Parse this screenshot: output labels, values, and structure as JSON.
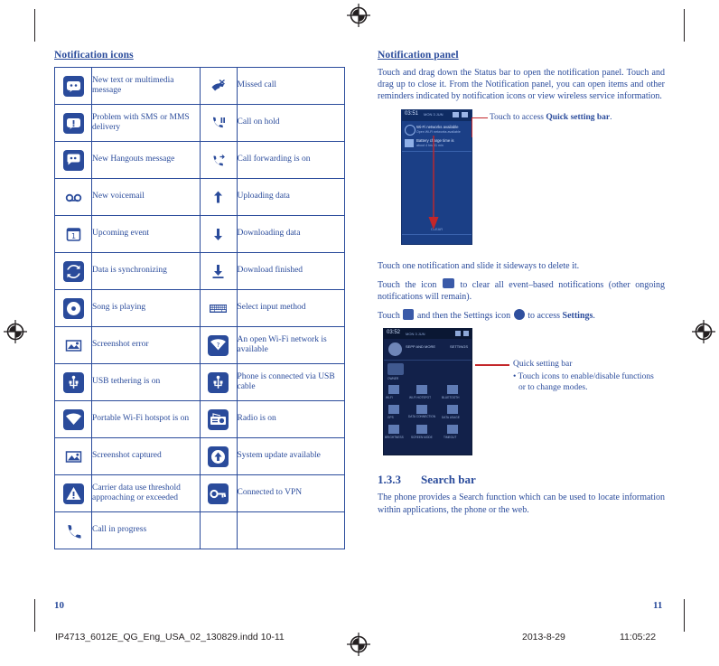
{
  "left": {
    "title": "Notification icons",
    "rows": [
      {
        "icon_left": "new-message-icon",
        "label_left": "New text or multimedia message",
        "icon_right": "missed-call-icon",
        "label_right": "Missed call"
      },
      {
        "icon_left": "sms-delivery-problem-icon",
        "label_left": "Problem with SMS or MMS delivery",
        "icon_right": "call-on-hold-icon",
        "label_right": "Call on hold"
      },
      {
        "icon_left": "hangouts-icon",
        "label_left": "New Hangouts message",
        "icon_right": "call-forwarding-icon",
        "label_right": "Call forwarding is on"
      },
      {
        "icon_left": "voicemail-icon",
        "label_left": "New voicemail",
        "icon_right": "upload-icon",
        "label_right": "Uploading data"
      },
      {
        "icon_left": "calendar-event-icon",
        "label_left": "Upcoming event",
        "icon_right": "download-icon",
        "label_right": "Downloading data"
      },
      {
        "icon_left": "sync-icon",
        "label_left": "Data is synchronizing",
        "icon_right": "download-finished-icon",
        "label_right": "Download finished"
      },
      {
        "icon_left": "music-icon",
        "label_left": "Song is playing",
        "icon_right": "keyboard-icon",
        "label_right": "Select input method"
      },
      {
        "icon_left": "screenshot-error-icon",
        "label_left": "Screenshot error",
        "icon_right": "open-wifi-icon",
        "label_right": "An open Wi-Fi network is available"
      },
      {
        "icon_left": "usb-tethering-icon",
        "label_left": "USB tethering is on",
        "icon_right": "usb-connected-icon",
        "label_right": "Phone is connected via USB cable"
      },
      {
        "icon_left": "portable-hotspot-icon",
        "label_left": "Portable Wi-Fi hotspot is on",
        "icon_right": "radio-icon",
        "label_right": "Radio is on"
      },
      {
        "icon_left": "screenshot-captured-icon",
        "label_left": "Screenshot captured",
        "icon_right": "system-update-icon",
        "label_right": "System update available"
      },
      {
        "icon_left": "carrier-data-warning-icon",
        "label_left": "Carrier data use threshold approaching or exceeded",
        "icon_right": "vpn-key-icon",
        "label_right": "Connected to VPN"
      },
      {
        "icon_left": "call-in-progress-icon",
        "label_left": "Call in progress",
        "icon_right": "",
        "label_right": ""
      }
    ]
  },
  "right": {
    "title": "Notification panel",
    "para1": "Touch and drag down the Status bar to open the notification panel. Touch and drag up to close it. From the Notification panel, you can open items and other reminders indicated by notification icons or view wireless service information.",
    "callout1_pre": "Touch to access ",
    "callout1_bold": "Quick setting bar",
    "callout1_post": ".",
    "para2": "Touch one notification and slide it sideways to delete it.",
    "para3_a": "Touch the icon",
    "para3_b": "to clear all event–based notifications (other ongoing notifications will remain).",
    "para4_a": "Touch",
    "para4_b": "and then the Settings icon",
    "para4_c": "to access",
    "para4_bold": "Settings",
    "para4_end": ".",
    "callout2_title": "Quick setting bar",
    "callout2_bullet": "• Touch icons to enable/disable functions or to change modes.",
    "section_number": "1.3.3",
    "section_title": "Search bar",
    "para5": "The phone provides a Search function which can be used to locate information within applications, the phone or the web.",
    "shot1": {
      "clock": "03:51",
      "date": "MON 3 JUN",
      "line1": "Wi-Fi networks available",
      "line2": "Open Wi-Fi networks available",
      "line3": "Battery charge time is",
      "line4": "about 4 hrs 51 min",
      "footer": "CLEAR"
    },
    "shot2": {
      "clock": "03:52",
      "date": "MON 3 JUN",
      "user": "SEPP AND MORE",
      "settings": "SETTINGS",
      "tiles": [
        "OWNER",
        "WI-FI",
        "WI-FI HOTSPOT",
        "BLUETOOTH",
        "GPS",
        "DATA CONNECTION",
        "DATA USAGE",
        "BRIGHTNESS",
        "SCREEN MODE",
        "TIMEOUT"
      ]
    }
  },
  "footer": {
    "page_left": "10",
    "page_right": "11",
    "imprint_file": "IP4713_6012E_QG_Eng_USA_02_130829.indd   10-11",
    "imprint_date": "2013-8-29",
    "imprint_time": "11:05:22"
  },
  "colors": {
    "brand": "#2a4b9b",
    "red_arrow": "#c3262a",
    "black": "#231f20"
  }
}
